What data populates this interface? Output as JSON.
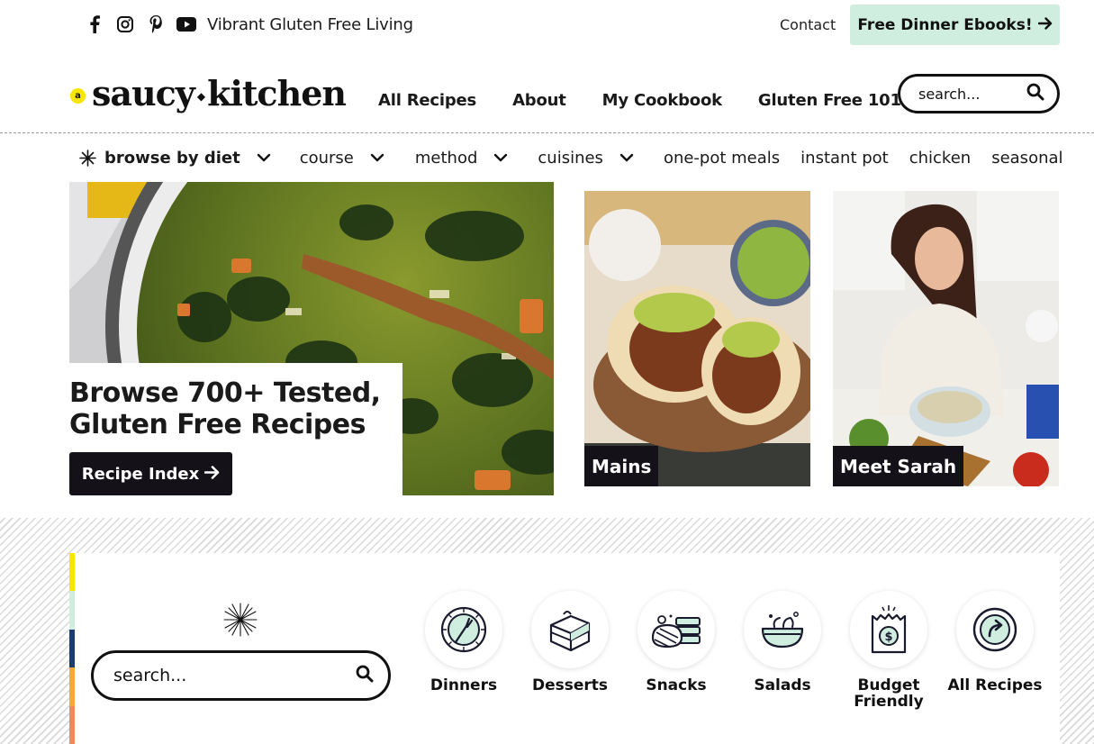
{
  "topbar": {
    "social_icons": [
      "facebook-icon",
      "instagram-icon",
      "pinterest-icon",
      "youtube-icon"
    ],
    "tagline": "Vibrant Gluten Free Living",
    "contact": "Contact",
    "ebooks_label": "Free Dinner Ebooks!"
  },
  "header": {
    "logo_a": "a",
    "logo_word1": "saucy",
    "logo_word2": "kitchen",
    "nav": [
      "All Recipes",
      "About",
      "My Cookbook",
      "Gluten Free 101"
    ],
    "search_placeholder": "search..."
  },
  "subnav": {
    "items": [
      "browse by diet",
      "course",
      "method",
      "cuisines",
      "one-pot meals",
      "instant pot",
      "chicken",
      "seasonal"
    ]
  },
  "hero": {
    "title": "Browse 700+ Tested, Gluten Free Recipes",
    "button": "Recipe Index"
  },
  "tiles": {
    "mains": "Mains",
    "meet_sarah": "Meet Sarah"
  },
  "categories": {
    "search_placeholder": "search...",
    "items": [
      {
        "label": "Dinners",
        "icon": "plate-fork-icon"
      },
      {
        "label": "Desserts",
        "icon": "cake-icon"
      },
      {
        "label": "Snacks",
        "icon": "snacks-icon"
      },
      {
        "label": "Salads",
        "icon": "salad-bowl-icon"
      },
      {
        "label": "Budget Friendly",
        "icon": "money-bag-icon"
      },
      {
        "label": "All Recipes",
        "icon": "arrow-circle-icon"
      }
    ]
  },
  "colors": {
    "ebooks_bg": "#cfeee0",
    "dark": "#151119",
    "logo_yellow": "#f7e600",
    "stripe": [
      "#f7e600",
      "#cfeee0",
      "#1d3d6e",
      "#f5a93b",
      "#ef8a5c"
    ]
  }
}
